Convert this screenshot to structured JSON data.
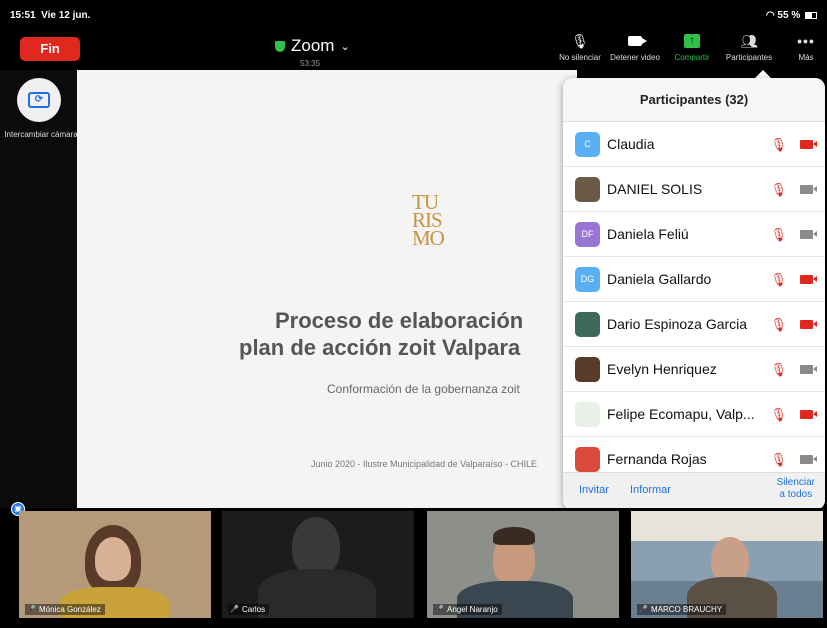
{
  "status_bar": {
    "time": "15:51",
    "date": "Vie 12 jun.",
    "battery": "55 %"
  },
  "toolbar": {
    "end_label": "Fin",
    "app_title": "Zoom",
    "timer": "53:35",
    "items": [
      {
        "label": "No silenciar",
        "icon": "mic-off-icon"
      },
      {
        "label": "Detener video",
        "icon": "camera-icon"
      },
      {
        "label": "Compartir",
        "icon": "share-icon"
      },
      {
        "label": "Participantes",
        "icon": "participants-icon"
      },
      {
        "label": "Más",
        "icon": "more-icon"
      }
    ]
  },
  "left_panel": {
    "swap_camera_label": "Intercambiar cámara"
  },
  "slide": {
    "logo_lines": [
      "TU",
      "RIS",
      "MO"
    ],
    "title_line1": "Proceso de elaboración",
    "title_line2": "plan de acción zoit Valpara",
    "subtitle": "Conformación de la gobernanza zoit",
    "footer": "Junio 2020 - Ilustre Municipalidad de Valparaíso - CHILE"
  },
  "participants": {
    "title": "Participantes (32)",
    "list": [
      {
        "name": "Claudia",
        "initials": "C",
        "avatar_color": "#5aaef3",
        "photo": false,
        "video_off": true
      },
      {
        "name": "DANIEL SOLIS",
        "initials": "",
        "avatar_color": "#6b5a48",
        "photo": true,
        "video_off": false
      },
      {
        "name": "Daniela Feliú",
        "initials": "DF",
        "avatar_color": "#9a76d4",
        "photo": false,
        "video_off": false
      },
      {
        "name": "Daniela Gallardo",
        "initials": "DG",
        "avatar_color": "#5aaef3",
        "photo": false,
        "video_off": true
      },
      {
        "name": "Dario Espinoza Garcia",
        "initials": "",
        "avatar_color": "#3d6a5a",
        "photo": true,
        "video_off": true
      },
      {
        "name": "Evelyn Henriquez",
        "initials": "",
        "avatar_color": "#5a3b2a",
        "photo": true,
        "video_off": false
      },
      {
        "name": "Felipe Ecomapu, Valp...",
        "initials": "",
        "avatar_color": "#e8f0e8",
        "photo": true,
        "video_off": true
      },
      {
        "name": "Fernanda Rojas",
        "initials": "",
        "avatar_color": "#d94a3a",
        "photo": true,
        "video_off": false
      }
    ],
    "invite_label": "Invitar",
    "report_label": "Informar",
    "mute_all_line1": "Silenciar",
    "mute_all_line2": "a todos"
  },
  "video_strip": [
    {
      "name": "Mónica González",
      "bg": "#b59a7a"
    },
    {
      "name": "Carlos",
      "bg": "#1c1c1c"
    },
    {
      "name": "Angel Naranjo",
      "bg": "#8c8f8a"
    },
    {
      "name": "MARCO BRAUCHY",
      "bg": "#6a7f90"
    }
  ]
}
